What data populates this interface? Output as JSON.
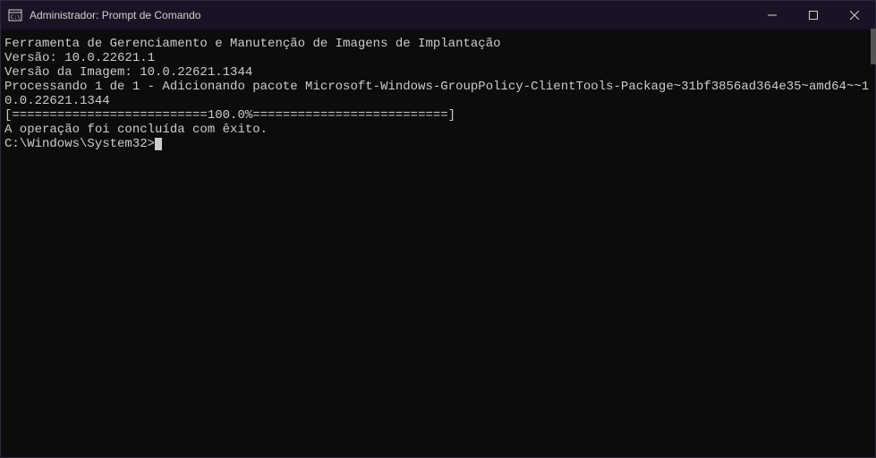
{
  "titlebar": {
    "title": "Administrador: Prompt de Comando"
  },
  "terminal": {
    "line1": "Ferramenta de Gerenciamento e Manutenção de Imagens de Implantação",
    "line2": "Versão: 10.0.22621.1",
    "line3": "",
    "line4": "Versão da Imagem: 10.0.22621.1344",
    "line5": "",
    "line6": "Processando 1 de 1 - Adicionando pacote Microsoft-Windows-GroupPolicy-ClientTools-Package~31bf3856ad364e35~amd64~~10.0.22621.1344",
    "line7": "[==========================100.0%==========================]",
    "line8": "A operação foi concluída com êxito.",
    "line9": "",
    "prompt": "C:\\Windows\\System32>"
  }
}
